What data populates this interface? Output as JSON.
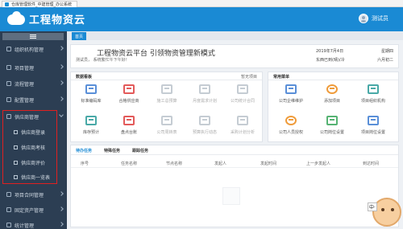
{
  "browser": {
    "tab_title": "仓库管理软件_中建管理_办公系统"
  },
  "header": {
    "app_name": "工程物资云",
    "user_name": "测试员"
  },
  "sidebar": {
    "items": [
      {
        "label": "组织机构管理"
      },
      {
        "label": "项目管理"
      },
      {
        "label": "流程管理"
      },
      {
        "label": "配置管理"
      },
      {
        "label": "供应商管理"
      },
      {
        "label": "项目合同管理"
      },
      {
        "label": "固定资产管理"
      },
      {
        "label": "统计管理"
      }
    ],
    "sub_items": [
      {
        "label": "供应商登录"
      },
      {
        "label": "供应商考核"
      },
      {
        "label": "供应商评价"
      },
      {
        "label": "供应商一览表"
      }
    ]
  },
  "page_tabs": {
    "current": "首页"
  },
  "welcome": {
    "title": "工程物资云平台 引领物资管理新模式",
    "greeting": "测试员，  系统繁忙午下午好！",
    "date": "2019年7月4日",
    "weekday": "星期四",
    "weather": "东西已到(晴)/冷",
    "day_text": "六月初二"
  },
  "data_panel": {
    "title": "数据看板",
    "more": "暂无项目",
    "tiles": [
      {
        "label": "标准编码库"
      },
      {
        "label": "合格供应商"
      },
      {
        "label": "施工总预算"
      },
      {
        "label": "月度需求计划"
      },
      {
        "label": "公司统计合同"
      },
      {
        "label": "库存预计"
      },
      {
        "label": "盘点台账"
      },
      {
        "label": "公司周转表"
      },
      {
        "label": "预算执行动态"
      },
      {
        "label": "采购计划分析"
      }
    ]
  },
  "common_panel": {
    "title": "常用菜单",
    "tiles": [
      {
        "label": "公司企维维护"
      },
      {
        "label": "添加项目"
      },
      {
        "label": "项目组织机构"
      },
      {
        "label": "公司人员授权"
      },
      {
        "label": "公司岗位设置"
      },
      {
        "label": "项目岗位设置"
      }
    ]
  },
  "tasks": {
    "tabs": [
      "待办任务",
      "特殊任务",
      "跟踪任务"
    ],
    "columns": [
      "序号",
      "任务名称",
      "节点名称",
      "发起人",
      "发起时间",
      "上一步发起人",
      "到达时间"
    ]
  },
  "overlay": {
    "ime_label": "中·"
  },
  "colors": {
    "primary": "#1a8ad4",
    "sidebar": "#2c3e53",
    "highlight_box": "#e02020"
  }
}
